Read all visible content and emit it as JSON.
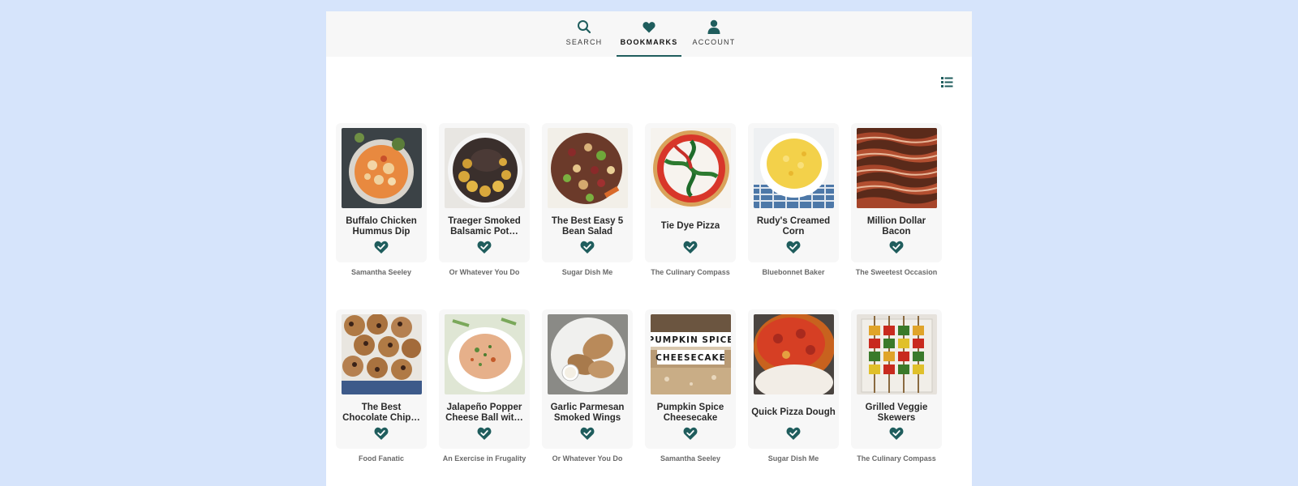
{
  "nav": {
    "items": [
      {
        "label": "SEARCH",
        "icon": "search-icon",
        "active": false
      },
      {
        "label": "BOOKMARKS",
        "icon": "heart-icon",
        "active": true
      },
      {
        "label": "ACCOUNT",
        "icon": "user-icon",
        "active": false
      }
    ]
  },
  "view_toggle": {
    "icon": "list-view-icon"
  },
  "colors": {
    "accent": "#1f5d5d",
    "background": "#d6e4fb",
    "card": "#f7f7f7"
  },
  "recipes": [
    {
      "title": "Buffalo Chicken Hummus Dip",
      "author": "Samantha Seeley",
      "bookmarked": true
    },
    {
      "title": "Traeger Smoked Balsamic Pot…",
      "author": "Or Whatever You Do",
      "bookmarked": true
    },
    {
      "title": "The Best Easy 5 Bean Salad",
      "author": "Sugar Dish Me",
      "bookmarked": true
    },
    {
      "title": "Tie Dye Pizza",
      "author": "The Culinary Compass",
      "bookmarked": true
    },
    {
      "title": "Rudy's Creamed Corn",
      "author": "Bluebonnet Baker",
      "bookmarked": true
    },
    {
      "title": "Million Dollar Bacon",
      "author": "The Sweetest Occasion",
      "bookmarked": true
    },
    {
      "title": "The Best Chocolate Chip…",
      "author": "Food Fanatic",
      "bookmarked": true
    },
    {
      "title": "Jalapeño Popper Cheese Ball wit…",
      "author": "An Exercise in Frugality",
      "bookmarked": true
    },
    {
      "title": "Garlic Parmesan Smoked Wings",
      "author": "Or Whatever You Do",
      "bookmarked": true
    },
    {
      "title": "Pumpkin Spice Cheesecake",
      "author": "Samantha Seeley",
      "bookmarked": true,
      "image_text": [
        "PUMPKIN SPICE",
        "CHEESECAKE"
      ]
    },
    {
      "title": "Quick Pizza Dough",
      "author": "Sugar Dish Me",
      "bookmarked": true
    },
    {
      "title": "Grilled Veggie Skewers",
      "author": "The Culinary Compass",
      "bookmarked": true
    }
  ]
}
